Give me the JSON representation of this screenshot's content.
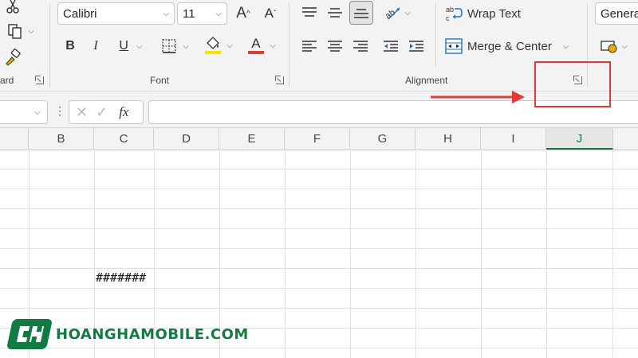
{
  "ribbon": {
    "clipboard": {
      "label": "ard"
    },
    "font": {
      "label": "Font",
      "family_value": "Calibri",
      "size_value": "11",
      "grow_label": "A",
      "shrink_label": "A",
      "bold_label": "B",
      "italic_label": "I",
      "underline_label": "U",
      "font_color_glyph": "A",
      "fill_color": "#f5e400",
      "font_color": "#e53935"
    },
    "alignment": {
      "label": "Alignment",
      "wrap_text_label": "Wrap Text",
      "merge_center_label": "Merge & Center"
    },
    "number": {
      "format_value": "General"
    }
  },
  "formula_bar": {
    "name_box_value": "",
    "fx_label": "fx",
    "formula_value": ""
  },
  "columns": [
    "B",
    "C",
    "D",
    "E",
    "F",
    "G",
    "H",
    "I",
    "J"
  ],
  "selected_column": "J",
  "cells": {
    "C7": "#######"
  },
  "watermark": {
    "text": "HOANGHAMOBILE.COM",
    "color": "#107c41"
  },
  "annotation": {
    "color": "#e53935"
  }
}
